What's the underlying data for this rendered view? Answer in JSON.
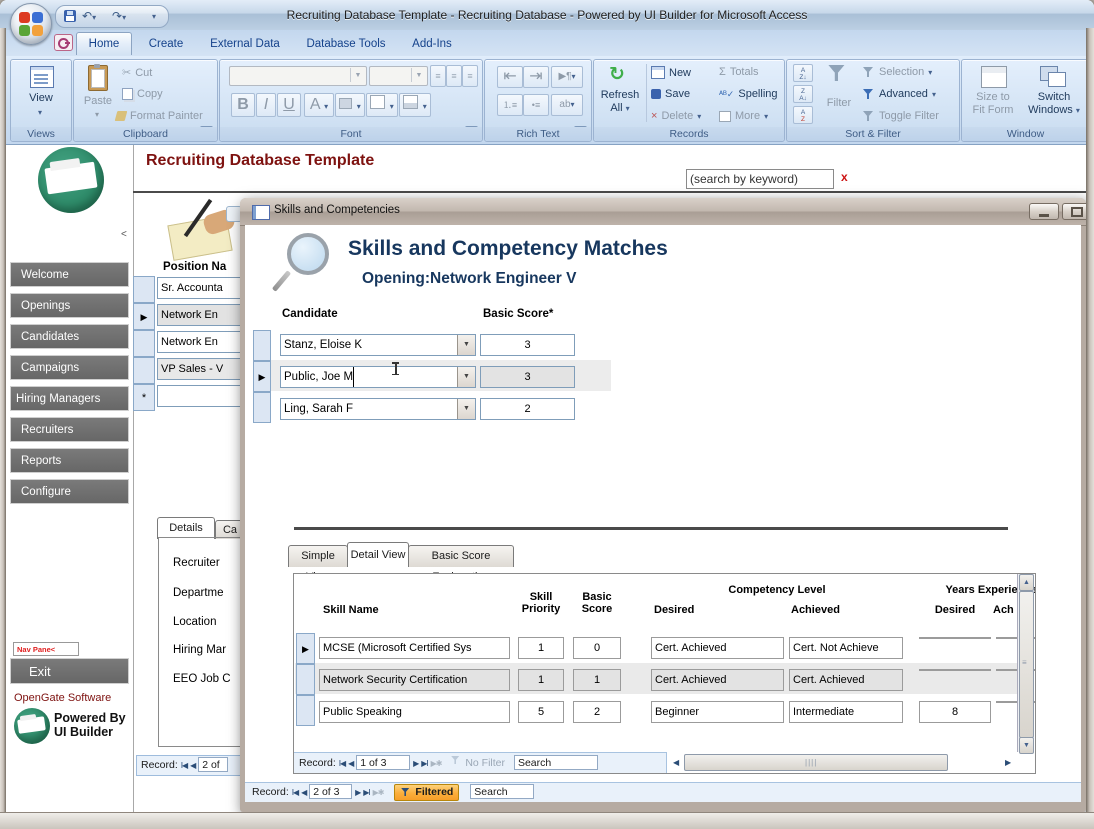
{
  "colors": {
    "maroon": "#7E1210",
    "navy": "#17375E",
    "filtered_orange": "#FBAE3C",
    "sidebar_gray": "#6F6F6F",
    "stripe": "#ECECEC"
  },
  "titlebar": {
    "title": "Recruiting Database Template - Recruiting Database - Powered by UI Builder for Microsoft Access"
  },
  "icons": {
    "office-orb": "office-logo",
    "save": "floppy",
    "undo": "↶",
    "redo": "↷",
    "qat-customize": "▾",
    "access-key": "key",
    "caret-down": "▾",
    "refresh": "↻",
    "sigma": "Σ",
    "spell-check": "✓",
    "scissors": "✂",
    "pilcrow": "¶",
    "magnifier": "magnifying-glass",
    "funnel": "filter-funnel",
    "writing-hand": "pen-on-paper"
  },
  "tabs": {
    "items": [
      "Home",
      "Create",
      "External Data",
      "Database Tools",
      "Add-Ins"
    ],
    "active": "Home"
  },
  "ribbon": {
    "views": {
      "label": "Views",
      "view": "View"
    },
    "clipboard": {
      "label": "Clipboard",
      "paste": "Paste",
      "cut": "Cut",
      "copy": "Copy",
      "format_painter": "Format Painter"
    },
    "font": {
      "label": "Font",
      "bold": "B",
      "italic": "I",
      "underline": "U",
      "color": "A"
    },
    "rich_text": {
      "label": "Rich Text",
      "ab": "ab"
    },
    "records": {
      "label": "Records",
      "refresh_line1": "Refresh",
      "refresh_line2": "All",
      "new": "New",
      "save": "Save",
      "delete": "Delete",
      "totals": "Totals",
      "spelling": "Spelling",
      "more": "More"
    },
    "sort_filter": {
      "label": "Sort & Filter",
      "filter": "Filter",
      "selection": "Selection",
      "advanced": "Advanced",
      "toggle": "Toggle Filter",
      "az": "AZ",
      "za": "ZA"
    },
    "window": {
      "label": "Window",
      "size_line1": "Size to",
      "size_line2": "Fit Form",
      "switch_line1": "Switch",
      "switch_line2": "Windows"
    }
  },
  "sidebar": {
    "collapse": "<",
    "items": [
      "Welcome",
      "Openings",
      "Candidates",
      "Campaigns",
      "Hiring Managers",
      "Recruiters",
      "Reports",
      "Configure"
    ],
    "nav_pane": "Nav Pane<",
    "exit": "Exit",
    "opengate": "OpenGate Software",
    "powered_line1": "Powered By",
    "powered_line2": "UI Builder"
  },
  "main": {
    "header": "Recruiting Database Template",
    "search_value": "(search by keyword)",
    "close_x": "x"
  },
  "background_form": {
    "position_label": "Position Na",
    "rows": [
      "Sr. Accounta",
      "Network En",
      "Network En",
      "VP Sales - V"
    ],
    "new_row_marker": "*",
    "details_tab": "Details",
    "second_tab": "Ca",
    "fields": [
      "Recruiter",
      "Departme",
      "Location",
      "Hiring Mar",
      "EEO Job C"
    ],
    "nav": {
      "record_label": "Record:",
      "record_value": "2 of"
    }
  },
  "dialog": {
    "title": "Skills and Competencies",
    "heading": "Skills and Competency Matches",
    "opening_label": "Opening:",
    "opening_value": "Network Engineer V",
    "candidate_col": "Candidate",
    "score_col": "Basic Score*",
    "candidates": [
      {
        "name": "Stanz, Eloise K",
        "score": "3"
      },
      {
        "name": "Public, Joe M",
        "score": "3"
      },
      {
        "name": "Ling, Sarah F",
        "score": "2"
      }
    ],
    "view_tabs": [
      "Simple View",
      "Detail View",
      "Basic Score Explanation"
    ],
    "active_tab": "Detail View",
    "nav": {
      "record_label": "Record:",
      "record_value": "2 of 3",
      "filtered": "Filtered",
      "search": "Search"
    }
  },
  "subform": {
    "headers": {
      "skill": "Skill Name",
      "priority_line1": "Skill",
      "priority_line2": "Priority",
      "score_line1": "Basic",
      "score_line2": "Score",
      "competency": "Competency Level",
      "desired": "Desired",
      "achieved": "Achieved",
      "years": "Years Experience",
      "years_desired": "Desired",
      "years_achieved": "Ach"
    },
    "rows": [
      {
        "skill": "MCSE (Microsoft Certified Sys",
        "priority": "1",
        "score": "0",
        "desired": "Cert. Achieved",
        "achieved": "Cert. Not Achieve",
        "years_desired": "",
        "years_achieved": ""
      },
      {
        "skill": "Network Security Certification",
        "priority": "1",
        "score": "1",
        "desired": "Cert. Achieved",
        "achieved": "Cert. Achieved",
        "years_desired": "",
        "years_achieved": ""
      },
      {
        "skill": "Public Speaking",
        "priority": "5",
        "score": "2",
        "desired": "Beginner",
        "achieved": "Intermediate",
        "years_desired": "8",
        "years_achieved": ""
      }
    ],
    "nav": {
      "record_label": "Record:",
      "record_value": "1 of 3",
      "no_filter": "No Filter",
      "search": "Search"
    }
  }
}
